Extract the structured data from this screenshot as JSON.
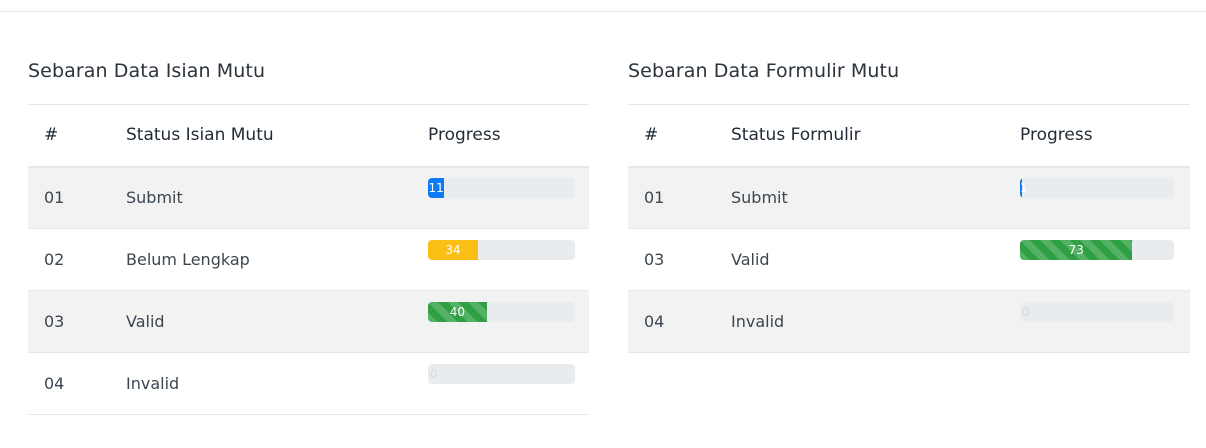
{
  "left_panel": {
    "title": "Sebaran Data Isian Mutu",
    "headers": [
      "#",
      "Status Isian Mutu",
      "Progress"
    ],
    "rows": [
      {
        "num": "01",
        "status": "Submit",
        "progress": 11,
        "color": "#0d7bf5"
      },
      {
        "num": "02",
        "status": "Belum Lengkap",
        "progress": 34,
        "color": "#fbbf16"
      },
      {
        "num": "03",
        "status": "Valid",
        "progress": 40,
        "color": "#2ea043"
      },
      {
        "num": "04",
        "status": "Invalid",
        "progress": 0,
        "color": "#e9ecef"
      }
    ]
  },
  "right_panel": {
    "title": "Sebaran Data Formulir Mutu",
    "headers": [
      "#",
      "Status Formulir",
      "Progress"
    ],
    "rows": [
      {
        "num": "01",
        "status": "Submit",
        "progress": 1,
        "color": "#0d7bf5"
      },
      {
        "num": "03",
        "status": "Valid",
        "progress": 73,
        "color": "#2ea043"
      },
      {
        "num": "04",
        "status": "Invalid",
        "progress": 0,
        "color": "#e9ecef"
      }
    ]
  }
}
